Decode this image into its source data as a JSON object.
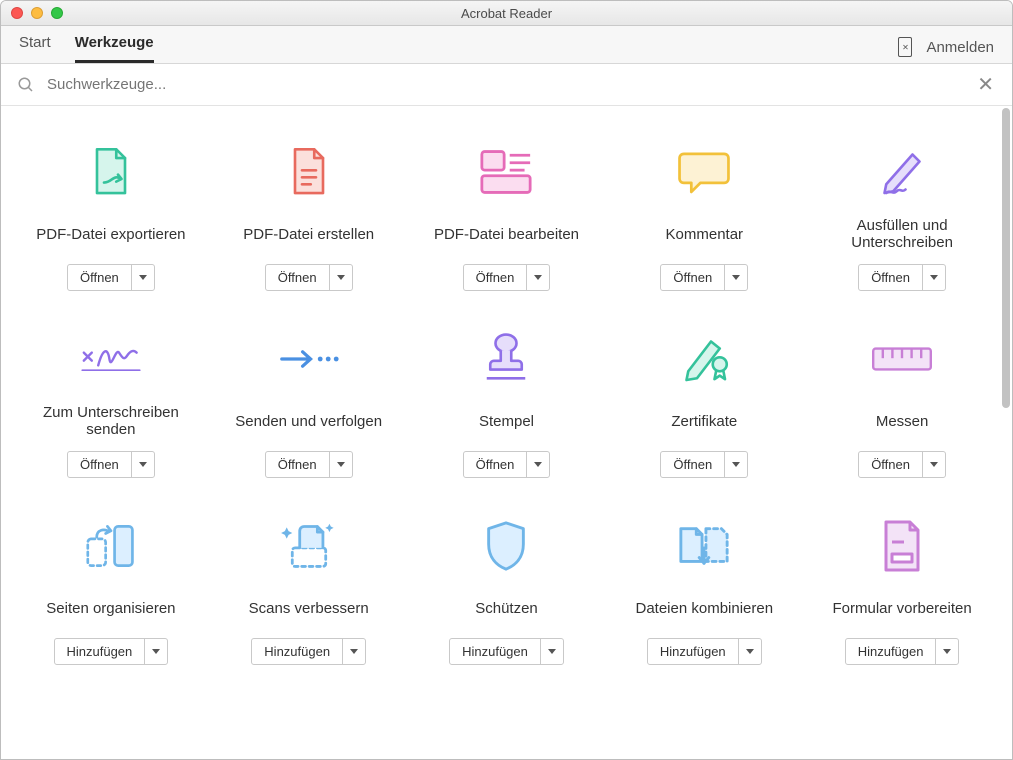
{
  "window": {
    "title": "Acrobat Reader"
  },
  "tabs": [
    {
      "label": "Start",
      "active": false
    },
    {
      "label": "Werkzeuge",
      "active": true
    }
  ],
  "header": {
    "sign_in": "Anmelden"
  },
  "search": {
    "placeholder": "Suchwerkzeuge..."
  },
  "actions": {
    "open": "Öffnen",
    "add": "Hinzufügen"
  },
  "tools": [
    {
      "id": "export-pdf",
      "label": "PDF-Datei exportieren",
      "action": "Öffnen"
    },
    {
      "id": "create-pdf",
      "label": "PDF-Datei erstellen",
      "action": "Öffnen"
    },
    {
      "id": "edit-pdf",
      "label": "PDF-Datei bearbeiten",
      "action": "Öffnen"
    },
    {
      "id": "comment",
      "label": "Kommentar",
      "action": "Öffnen"
    },
    {
      "id": "fill-sign",
      "label": "Ausfüllen und Unterschreiben",
      "action": "Öffnen"
    },
    {
      "id": "send-signature",
      "label": "Zum Unterschreiben senden",
      "action": "Öffnen"
    },
    {
      "id": "send-track",
      "label": "Senden und verfolgen",
      "action": "Öffnen"
    },
    {
      "id": "stamp",
      "label": "Stempel",
      "action": "Öffnen"
    },
    {
      "id": "certificates",
      "label": "Zertifikate",
      "action": "Öffnen"
    },
    {
      "id": "measure",
      "label": "Messen",
      "action": "Öffnen"
    },
    {
      "id": "organize-pages",
      "label": "Seiten organisieren",
      "action": "Hinzufügen"
    },
    {
      "id": "enhance-scans",
      "label": "Scans verbessern",
      "action": "Hinzufügen"
    },
    {
      "id": "protect",
      "label": "Schützen",
      "action": "Hinzufügen"
    },
    {
      "id": "combine-files",
      "label": "Dateien kombinieren",
      "action": "Hinzufügen"
    },
    {
      "id": "prepare-form",
      "label": "Formular vorbereiten",
      "action": "Hinzufügen"
    }
  ]
}
